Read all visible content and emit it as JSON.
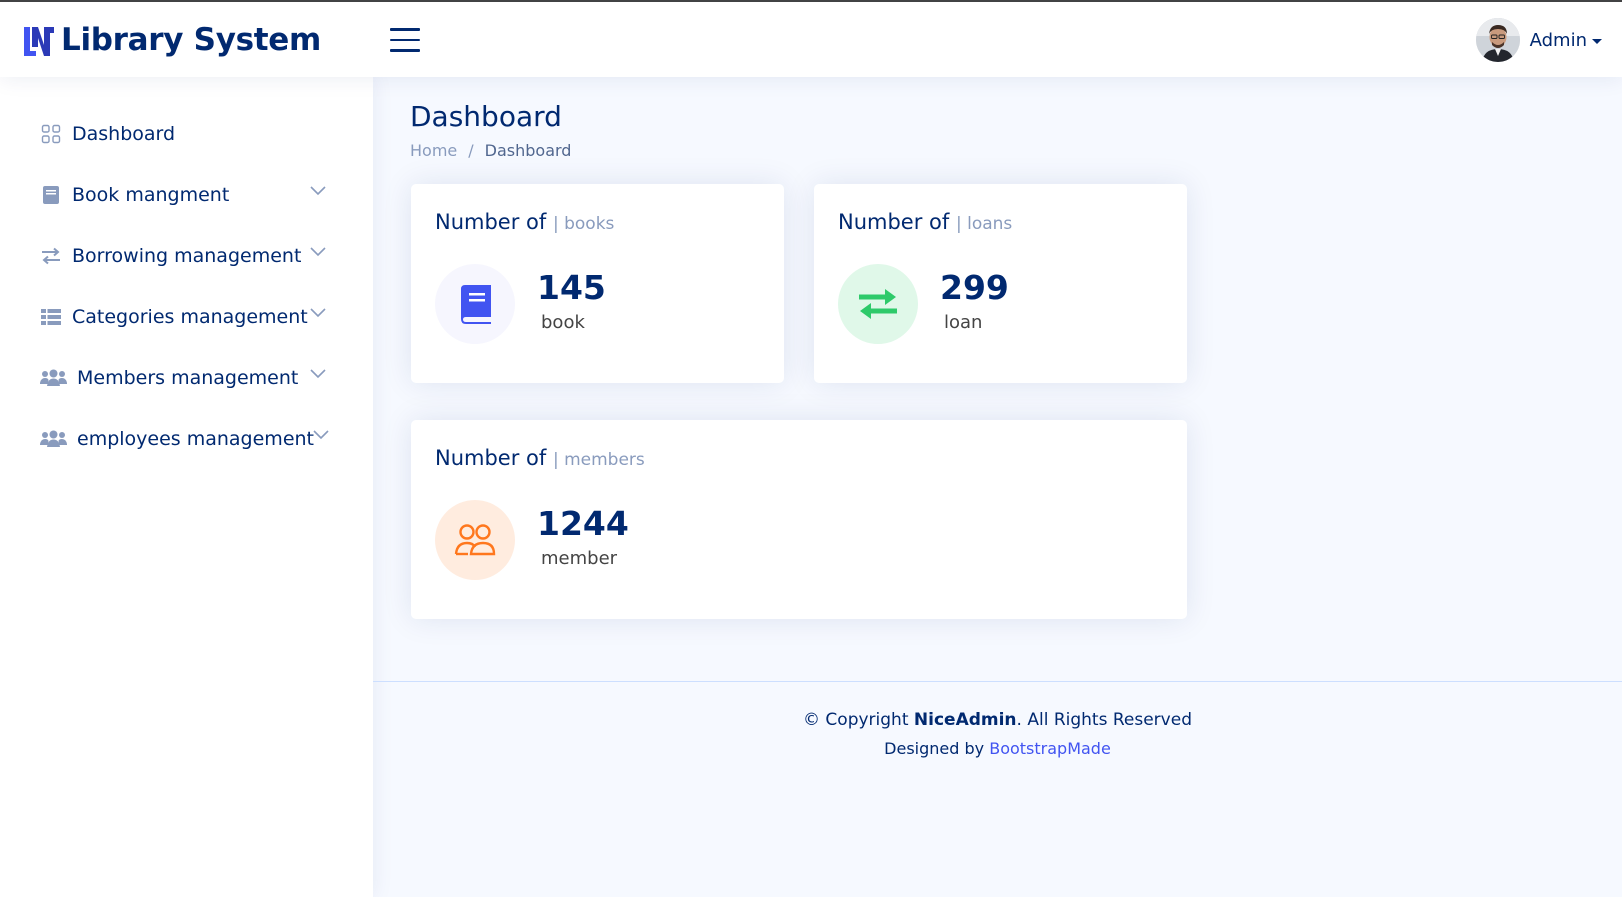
{
  "app": {
    "title": "Library System",
    "accent": "#4154f1",
    "navy": "#012970"
  },
  "header": {
    "menu_icon": "hamburger-icon",
    "profile_name": "Admin"
  },
  "sidebar": {
    "items": [
      {
        "label": "Dashboard",
        "icon": "grid-icon"
      },
      {
        "label": "Book mangment",
        "icon": "book-icon"
      },
      {
        "label": "Borrowing management",
        "icon": "arrows-icon"
      },
      {
        "label": "Categories management",
        "icon": "list-icon"
      },
      {
        "label": "Members management",
        "icon": "people-icon"
      },
      {
        "label": "employees management",
        "icon": "people-icon"
      }
    ]
  },
  "page": {
    "title": "Dashboard",
    "breadcrumb": {
      "home": "Home",
      "separator": "/",
      "current": "Dashboard"
    }
  },
  "cards": {
    "books": {
      "title": "Number of",
      "subtitle": "| books",
      "value": "145",
      "unit": "book",
      "icon": "book-icon",
      "icon_bg": "#f6f6fe",
      "icon_color": "#4154f1"
    },
    "loans": {
      "title": "Number of",
      "subtitle": "| loans",
      "value": "299",
      "unit": "loan",
      "icon": "swap-arrows-icon",
      "icon_bg": "#e0f8e9",
      "icon_color": "#2eca6a"
    },
    "members": {
      "title": "Number of",
      "subtitle": "| members",
      "value": "1244",
      "unit": "member",
      "icon": "people-outline-icon",
      "icon_bg": "#ffecdf",
      "icon_color": "#ff771d"
    }
  },
  "footer": {
    "copyright_prefix": "© Copyright",
    "brand": "NiceAdmin",
    "copyright_suffix": ". All Rights Reserved",
    "designed_by": "Designed by",
    "designer": "BootstrapMade"
  }
}
